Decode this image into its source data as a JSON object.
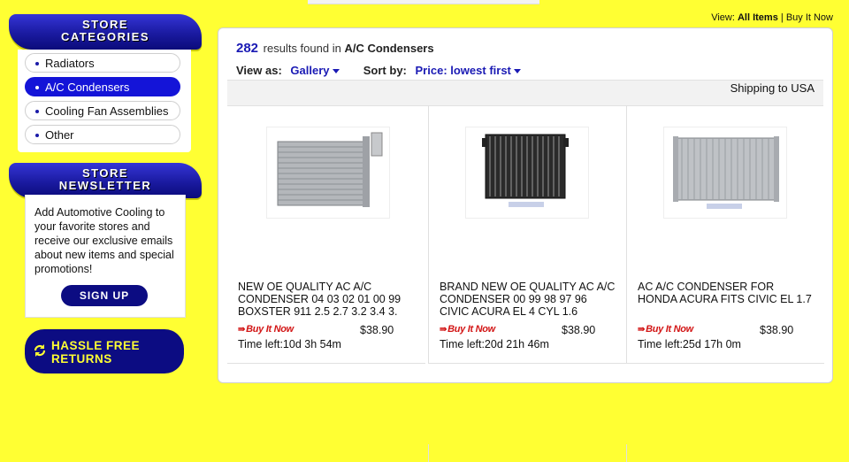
{
  "sidebar": {
    "categories_banner": [
      "STORE",
      "CATEGORIES"
    ],
    "categories": [
      {
        "label": "Radiators",
        "active": false
      },
      {
        "label": "A/C Condensers",
        "active": true
      },
      {
        "label": "Cooling Fan Assemblies",
        "active": false
      },
      {
        "label": "Other",
        "active": false
      }
    ],
    "newsletter_banner": [
      "STORE",
      "NEWSLETTER"
    ],
    "newsletter_text": "Add Automotive Cooling to your favorite stores and receive our exclusive emails about new items and special promotions!",
    "signup_label": "SIGN UP",
    "hassle_label": [
      "HASSLE FREE",
      "RETURNS"
    ]
  },
  "view": {
    "prefix": "View:",
    "current": "All Items",
    "sep": "|",
    "other": "Buy It Now"
  },
  "results": {
    "count": "282",
    "text": "results found in",
    "category": "A/C Condensers"
  },
  "controls": {
    "view_label": "View as:",
    "view_value": "Gallery",
    "sort_label": "Sort by:",
    "sort_value": "Price: lowest first"
  },
  "shipping": "Shipping to USA",
  "listings": [
    {
      "title": "NEW OE QUALITY AC A/C CONDENSER 04 03 02 01 00 99 BOXSTER 911 2.5 2.7 3.2 3.4 3.",
      "buy_label": "Buy It Now",
      "price": "$38.90",
      "time_left": "Time left:10d 3h 54m"
    },
    {
      "title": "BRAND NEW OE QUALITY AC A/C CONDENSER 00 99 98 97 96 CIVIC ACURA EL 4 CYL 1.6",
      "buy_label": "Buy It Now",
      "price": "$38.90",
      "time_left": "Time left:20d 21h 46m"
    },
    {
      "title": "AC A/C CONDENSER FOR HONDA ACURA FITS CIVIC EL 1.7",
      "buy_label": "Buy It Now",
      "price": "$38.90",
      "time_left": "Time left:25d 17h 0m"
    }
  ],
  "colors": {
    "page_bg": "#ffff33",
    "brand_blue": "#1414d8",
    "navy": "#0c0c82",
    "link_blue": "#1a1ab4",
    "buy_now_red": "#d21414"
  }
}
